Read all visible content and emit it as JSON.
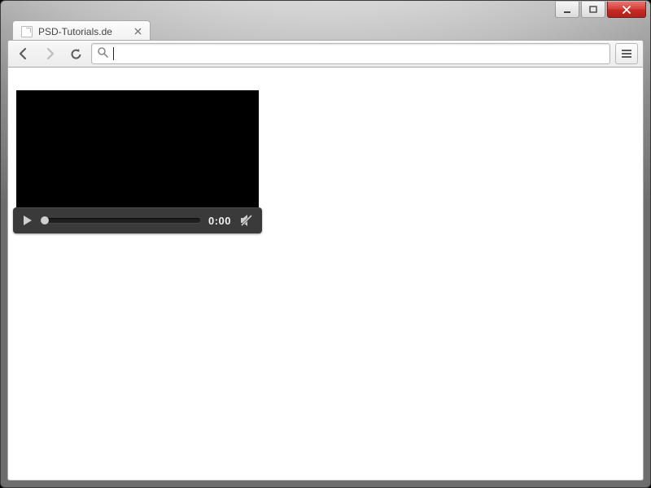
{
  "tab": {
    "title": "PSD-Tutorials.de"
  },
  "omnibox": {
    "value": ""
  },
  "video": {
    "time": "0:00"
  }
}
